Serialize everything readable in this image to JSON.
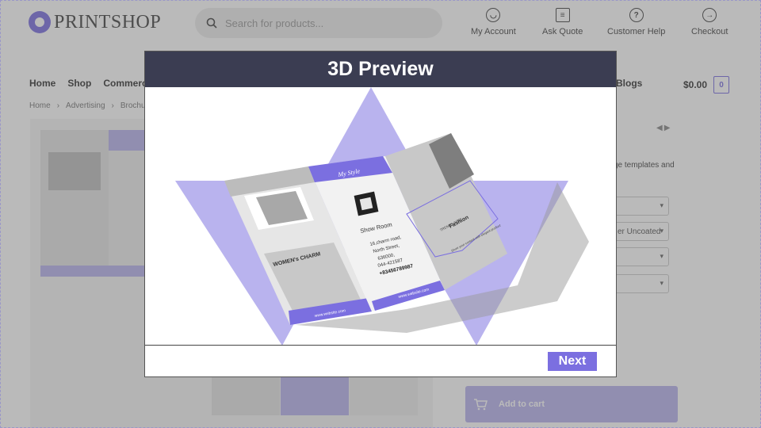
{
  "header": {
    "logo": "PRINTSHOP",
    "search_placeholder": "Search for products...",
    "links": {
      "account": "My Account",
      "quote": "Ask Quote",
      "help": "Customer Help",
      "checkout": "Checkout"
    }
  },
  "nav": {
    "items": [
      "Home",
      "Shop",
      "Commerc"
    ],
    "blogs": "Blogs",
    "cart_total": "$0.00",
    "cart_count": "0"
  },
  "breadcrumb": [
    "Home",
    "Advertising",
    "Brochure("
  ],
  "product": {
    "description_fragment": "ge templates and",
    "select_visible_value": "er Uncoated",
    "add_to_cart": "Add to cart"
  },
  "brochure": {
    "panel_left_title": "WOMEN's CHARM",
    "center_script": "My Style",
    "center_heading": "Show Room",
    "address": [
      "16,charm road,",
      "North Street,",
      "636000,",
      "044-421587"
    ],
    "phone": "+83456789987",
    "website": "www.website.com",
    "right_small": "TRENDS FOR",
    "right_title": "Fashion",
    "right_sub": "Show your content with elegant product"
  },
  "modal": {
    "title": "3D Preview",
    "next": "Next"
  },
  "colors": {
    "accent": "#7b6fe0",
    "accent_light": "#b9b3ee",
    "modal_header": "#3b3d52"
  }
}
